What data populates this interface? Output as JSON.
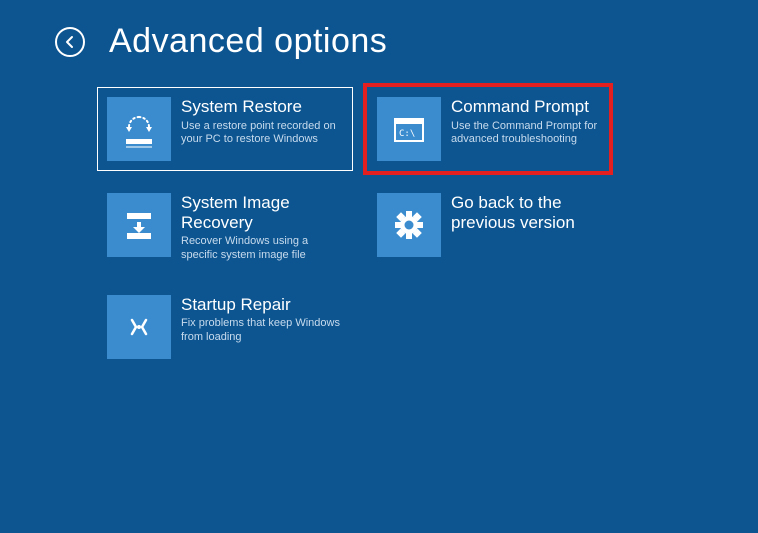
{
  "pageTitle": "Advanced options",
  "tiles": {
    "systemRestore": {
      "title": "System Restore",
      "desc": "Use a restore point recorded on your PC to restore Windows"
    },
    "commandPrompt": {
      "title": "Command Prompt",
      "desc": "Use the Command Prompt for advanced troubleshooting"
    },
    "systemImageRecovery": {
      "title": "System Image Recovery",
      "desc": "Recover Windows using a specific system image file"
    },
    "goBack": {
      "title": "Go back to the previous version",
      "desc": ""
    },
    "startupRepair": {
      "title": "Startup Repair",
      "desc": "Fix problems that keep Windows from loading"
    }
  }
}
